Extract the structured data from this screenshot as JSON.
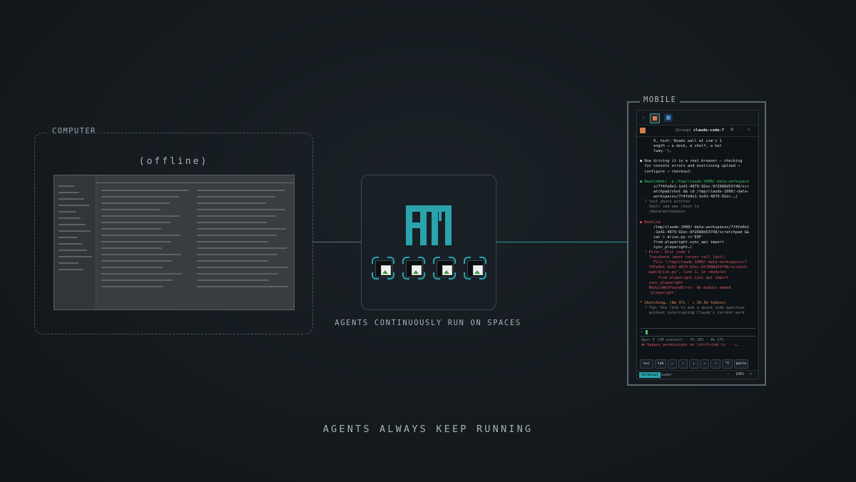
{
  "labels": {
    "computer": "COMPUTER",
    "offline": "(offline)",
    "mobile": "MOBILE",
    "agents_caption": "AGENTS CONTINUOUSLY RUN ON SPACES",
    "footer": "AGENTS ALWAYS KEEP RUNNING"
  },
  "colors": {
    "accent": "#2aa3ad",
    "background": "#141a1e"
  },
  "center_card": {
    "logo_icon": "am-logo-icon",
    "agent_icons": [
      "broken-image-icon",
      "broken-image-icon",
      "broken-image-icon",
      "broken-image-icon"
    ]
  },
  "mobile": {
    "header_group": "[Group]",
    "header_title": "claude-code-7",
    "terminal_lines": [
      {
        "cls": "t-white",
        "text": "      0, hint:'Roads wall at sim's 1"
      },
      {
        "cls": "t-white",
        "text": "      ength → a desk, a shelf, a hal"
      },
      {
        "cls": "t-white",
        "text": "      lway.'),"
      },
      {
        "cls": "",
        "text": ""
      },
      {
        "cls": "t-white",
        "text": "● Now driving it in a real browser — checking"
      },
      {
        "cls": "t-white",
        "text": "  for console errors and exercising upload →"
      },
      {
        "cls": "t-white",
        "text": "  configure → checkout:"
      },
      {
        "cls": "",
        "text": ""
      },
      {
        "cls": "t-green",
        "text": "● Bash(mkdir -p /tmp/claude-1000/-data-workspace"
      },
      {
        "cls": "t-white",
        "text": "      s/7f4fe0e1-1e41-4879-92ec-9f2688d53748/scr"
      },
      {
        "cls": "t-white",
        "text": "      atchpad/shot && cd /tmp/claude-1000/-data-"
      },
      {
        "cls": "t-white",
        "text": "      workspaces/7f4fe0e1-1e41-4879-92ec-…)"
      },
      {
        "cls": "t-dim",
        "text": "  └ test photo written"
      },
      {
        "cls": "t-dim",
        "text": "    Shell cwd was reset to"
      },
      {
        "cls": "t-dim",
        "text": "    /data/workspaces"
      },
      {
        "cls": "",
        "text": ""
      },
      {
        "cls": "t-red",
        "text": "● Bash(cd"
      },
      {
        "cls": "t-white",
        "text": "      /tmp/claude-1000/-data-workspaces/7f4fe0e1"
      },
      {
        "cls": "t-white",
        "text": "      -1e41-4879-92ec-9f2688d53748/scratchpad &&"
      },
      {
        "cls": "t-white",
        "text": "      cat > drive.py <<'EOF'"
      },
      {
        "cls": "t-white",
        "text": "      from playwright.sync_api import"
      },
      {
        "cls": "t-white",
        "text": "      sync_playwright…)"
      },
      {
        "cls": "t-red",
        "text": "  └ Error: Exit code 1"
      },
      {
        "cls": "t-red",
        "text": "    Traceback (most recent call last):"
      },
      {
        "cls": "t-red",
        "text": "      File \"/tmp/claude-1000/-data-workspaces/7"
      },
      {
        "cls": "t-red",
        "text": "    f4fe0e1-1e41-4879-92ec-9f2688d53748/scratch"
      },
      {
        "cls": "t-red",
        "text": "    pad/drive.py\", line 1, in <module>"
      },
      {
        "cls": "t-red",
        "text": "        from playwright.sync_api import"
      },
      {
        "cls": "t-red",
        "text": "    sync_playwright"
      },
      {
        "cls": "t-red",
        "text": "    ModuleNotFoundError: No module named"
      },
      {
        "cls": "t-red",
        "text": "    'playwright'"
      },
      {
        "cls": "",
        "text": ""
      },
      {
        "cls": "t-orange",
        "text": "* Sketching… (8m 37s · ↓ 10.3k tokens)"
      },
      {
        "cls": "t-dim",
        "text": "  └ Tip: Use /btw to ask a quick side question"
      },
      {
        "cls": "t-dim",
        "text": "    without interrupting Claude's current work"
      }
    ],
    "prompt": "›",
    "status_line1": "Opus 5 (1M context) · 5% 28% · 4k 17%",
    "status_line2": "⏵⏵ bypass permissions on (shift+tab to  · ←…",
    "keys": [
      "esc",
      "tab",
      "←",
      "↑",
      "↓",
      "→",
      "⏎",
      "^C",
      "paste"
    ],
    "bottom_tabs": [
      "terminal",
      "reader"
    ],
    "zoom": "100%",
    "zoom_minus": "−",
    "zoom_plus": "+"
  }
}
